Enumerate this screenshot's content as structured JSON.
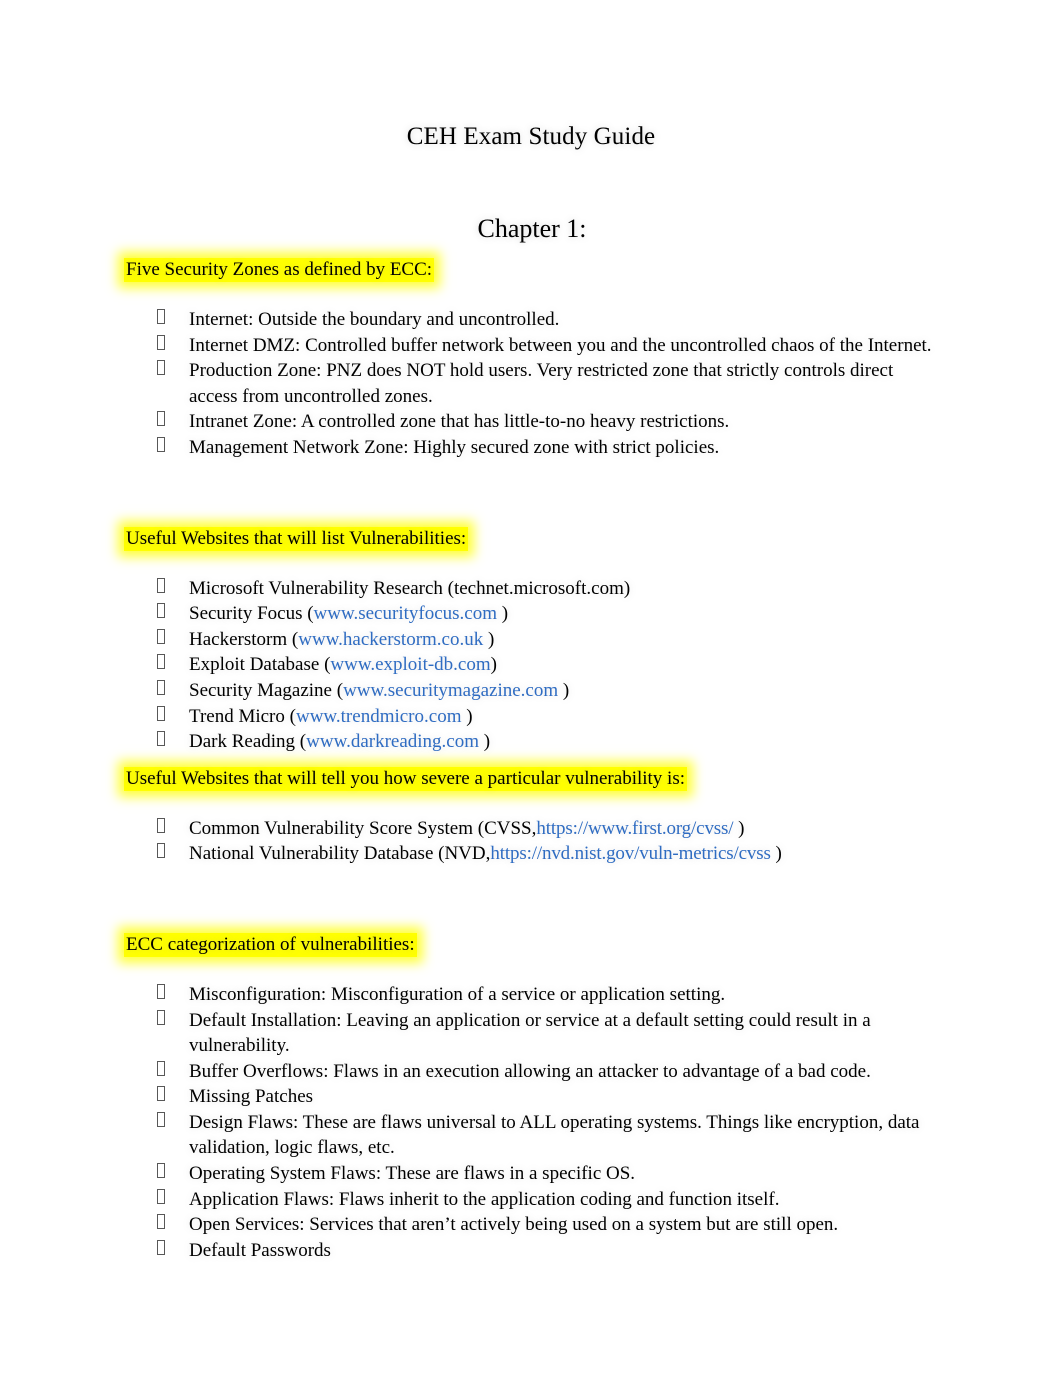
{
  "document": {
    "title": "CEH Exam Study Guide",
    "chapter": "Chapter 1:"
  },
  "colors": {
    "highlight": "#ffff00",
    "link": "#2f6cc2",
    "text": "#000000",
    "page_background": "#ffffff"
  },
  "bullet_glyph": "missing-glyph-box",
  "sections": [
    {
      "id": "five-security-zones",
      "heading": "Five Security Zones as defined by ECC:",
      "highlighted": true,
      "items": [
        {
          "text": "Internet:  Outside the boundary and uncontrolled."
        },
        {
          "text": "Internet DMZ: Controlled buffer network between you and the uncontrolled chaos of the Internet."
        },
        {
          "text": "Production Zone:  PNZ does NOT hold users. Very restricted zone that strictly controls direct access from uncontrolled zones."
        },
        {
          "text": "Intranet Zone:  A controlled zone that has little-to-no heavy restrictions."
        },
        {
          "text": "Management Network Zone:   Highly secured zone with strict policies."
        }
      ]
    },
    {
      "id": "useful-websites-list-vulnerabilities",
      "heading": "Useful Websites that will list Vulnerabilities:",
      "highlighted": true,
      "items": [
        {
          "label": "Microsoft Vulnerability Research (technet.microsoft.com)",
          "link": "",
          "pre": "",
          "post": ""
        },
        {
          "label": "",
          "pre": "Security Focus (",
          "link": "www.securityfocus.com",
          "post": " )"
        },
        {
          "label": "",
          "pre": "Hackerstorm (",
          "link": "www.hackerstorm.co.uk",
          "post": " )"
        },
        {
          "label": "",
          "pre": "Exploit Database (",
          "link": "www.exploit-db.com",
          "post": ")"
        },
        {
          "label": "",
          "pre": "Security Magazine (",
          "link": "www.securitymagazine.com",
          "post": " )"
        },
        {
          "label": "",
          "pre": "Trend Micro (",
          "link": "www.trendmicro.com",
          "post": " )"
        },
        {
          "label": "",
          "pre": "Dark Reading (",
          "link": "www.darkreading.com",
          "post": " )"
        }
      ]
    },
    {
      "id": "useful-websites-severity",
      "heading": "Useful Websites that will tell you how severe a particular vulnerability is:",
      "highlighted": true,
      "items": [
        {
          "pre": "Common Vulnerability Score System (CVSS,",
          "link": "https://www.first.org/cvss/",
          "post": "  )"
        },
        {
          "pre": "National Vulnerability Database (NVD,",
          "link": "https://nvd.nist.gov/vuln-metrics/cvss",
          "post": "  )"
        }
      ]
    },
    {
      "id": "ecc-categorization",
      "heading": "ECC categorization of vulnerabilities:",
      "highlighted": true,
      "items": [
        {
          "text": "Misconfiguration:  Misconfiguration of a service or application setting."
        },
        {
          "text": "Default Installation:  Leaving an application or service at a default setting could result in a vulnerability."
        },
        {
          "text": "Buffer Overflows: Flaws in an execution allowing an attacker to advantage of a bad code."
        },
        {
          "text": "Missing Patches"
        },
        {
          "text": "Design Flaws: These are flaws universal to ALL operating systems. Things like encryption, data validation, logic flaws, etc."
        },
        {
          "text": "Operating System Flaws:  These are flaws in a specific OS."
        },
        {
          "text": "Application Flaws: Flaws inherit to the application coding and function itself."
        },
        {
          "text": "Open Services: Services that aren’t actively being used on a system but are still open."
        },
        {
          "text": "Default Passwords"
        }
      ]
    }
  ]
}
